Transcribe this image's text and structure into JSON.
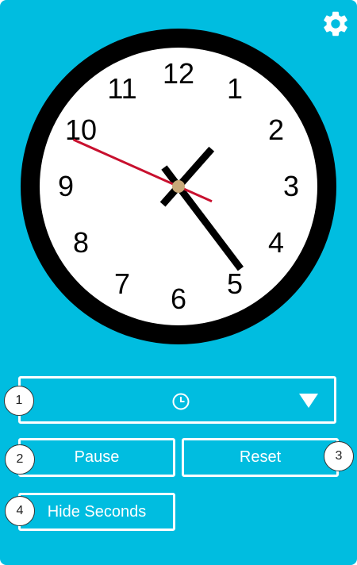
{
  "settings": {
    "icon": "gear-icon"
  },
  "clock": {
    "numerals": [
      "12",
      "1",
      "2",
      "3",
      "4",
      "5",
      "6",
      "7",
      "8",
      "9",
      "10",
      "11"
    ],
    "time": {
      "hours": 1,
      "minutes": 23,
      "seconds": 49
    },
    "colors": {
      "face": "#ffffff",
      "bezel": "#000000",
      "hands": "#000000",
      "second_hand": "#c8102e",
      "center_cap": "#c8a878"
    }
  },
  "mode_select": {
    "icon": "clock-icon",
    "selected_label": "",
    "arrow_icon": "triangle-down-icon"
  },
  "buttons": {
    "pause_label": "Pause",
    "reset_label": "Reset",
    "hide_seconds_label": "Hide Seconds"
  },
  "badges": [
    "1",
    "2",
    "3",
    "4"
  ],
  "theme": {
    "background": "#00bde0",
    "foreground": "#ffffff"
  }
}
